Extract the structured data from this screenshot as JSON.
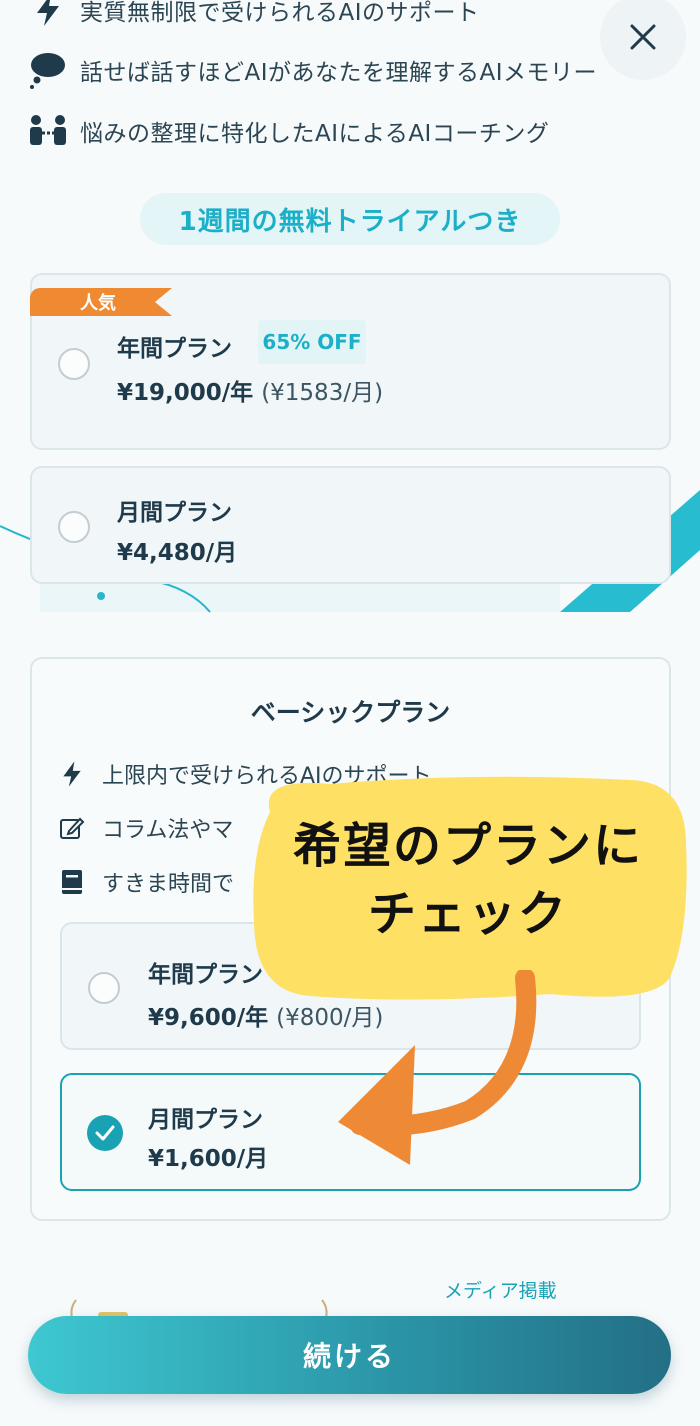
{
  "header": {
    "close_icon": "close-icon"
  },
  "premium": {
    "features": [
      {
        "icon": "lightning-icon",
        "text": "実質無制限で受けられるAIのサポート"
      },
      {
        "icon": "brain-cloud-icon",
        "text": "話せば話すほどAIがあなたを理解するAIメモリー"
      },
      {
        "icon": "coaching-icon",
        "text": "悩みの整理に特化したAIによるAIコーチング"
      }
    ],
    "trial_label": "1週間の無料トライアルつき",
    "popular_badge": "人気",
    "annual": {
      "name": "年間プラン",
      "discount": "65% OFF",
      "price": "¥19,000/年",
      "monthly_equiv": "(¥1583/月)"
    },
    "monthly": {
      "name": "月間プラン",
      "price": "¥4,480/月"
    }
  },
  "basic": {
    "title": "ベーシックプラン",
    "features": [
      {
        "icon": "lightning-icon",
        "text": "上限内で受けられるAIのサポート"
      },
      {
        "icon": "edit-icon",
        "text": "コラム法やマ"
      },
      {
        "icon": "book-icon",
        "text": "すきま時間で"
      }
    ],
    "annual": {
      "name": "年間プラン",
      "price": "¥9,600/年",
      "monthly_equiv": "(¥800/月)"
    },
    "monthly": {
      "name": "月間プラン",
      "price": "¥1,600/月",
      "selected": true
    }
  },
  "callout": {
    "line1": "希望のプランに",
    "line2": "チェック"
  },
  "media": {
    "label": "メディア掲載"
  },
  "cta": {
    "label": "続ける"
  },
  "colors": {
    "accent": "#19a2b3",
    "badge_orange": "#ef8a33",
    "callout_yellow": "#fde064",
    "arrow_orange": "#ee8a35"
  }
}
